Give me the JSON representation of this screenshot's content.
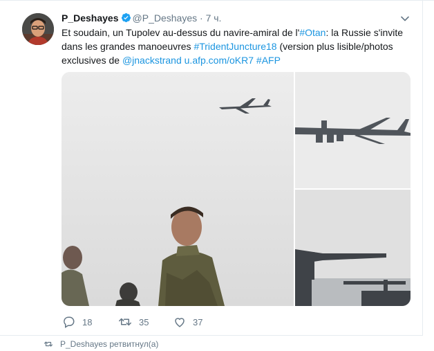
{
  "tweet": {
    "author_name": "P_Deshayes",
    "author_handle": "@P_Deshayes",
    "separator": "·",
    "time": "7 ч.",
    "text": {
      "part1": "Et soudain, un Tupolev au-dessus du navire-amiral de l'",
      "hashtag_otan": "#Otan",
      "part2": ": la Russie s'invite dans les grandes manoeuvres ",
      "hashtag_trident": "#TridentJuncture18",
      "part3": " (version plus lisible/photos exclusives de ",
      "mention": "@jnackstrand",
      "part4": " ",
      "link": "u.afp.com/oKR7",
      "part5": " ",
      "hashtag_afp": "#AFP"
    },
    "actions": {
      "reply_count": "18",
      "retweet_count": "35",
      "like_count": "37"
    }
  },
  "next_item": {
    "retweeted_by": "P_Deshayes ретвитнул(а)"
  },
  "colors": {
    "link": "#1b95e0",
    "secondary": "#657786",
    "verified": "#1da1f2"
  }
}
